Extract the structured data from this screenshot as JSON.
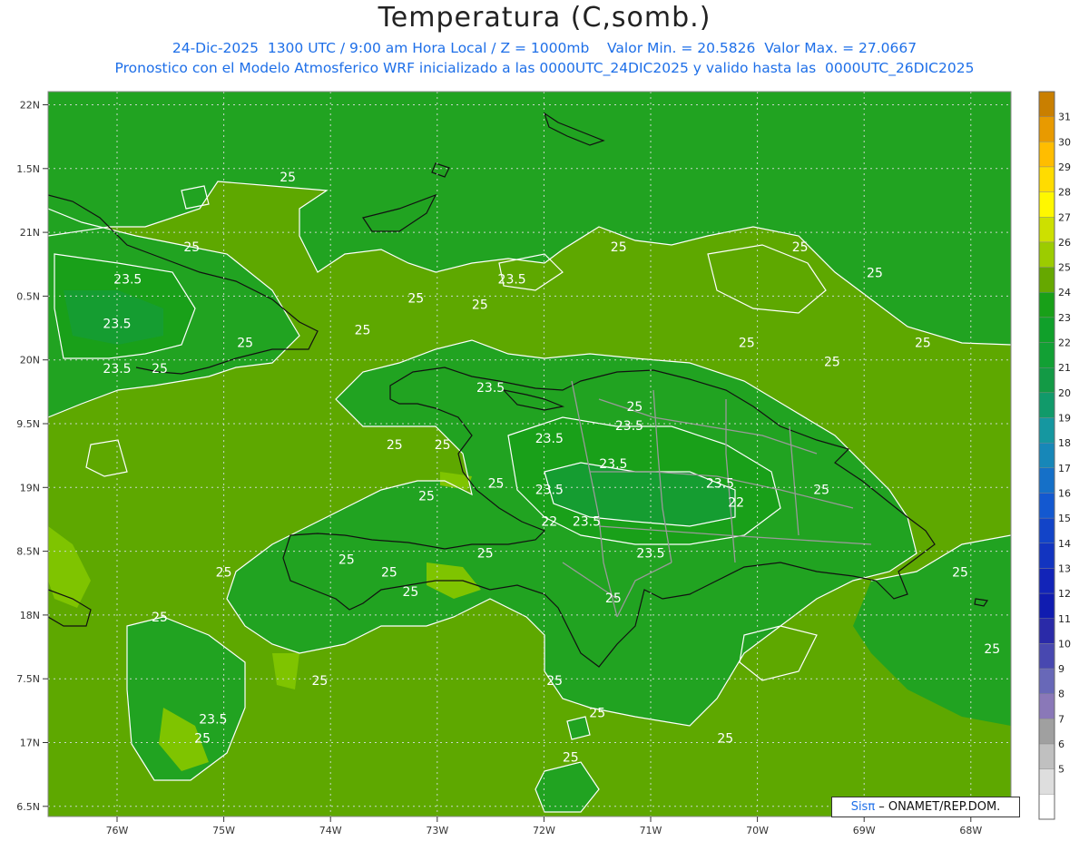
{
  "title": "Temperatura (C,somb.)",
  "subtitle_line1": "24-Dic-2025  1300 UTC / 9:00 am Hora Local / Z = 1000mb    Valor Min. = 20.5826  Valor Max. = 27.0667",
  "subtitle_line2": "Pronostico con el Modelo Atmosferico WRF inicializado a las 0000UTC_24DIC2025 y valido hasta las  0000UTC_26DIC2025",
  "credit": {
    "brand": "Sisπ",
    "text": " – ONAMET/REP.DOM."
  },
  "axes": {
    "lon_labels": [
      "76W",
      "75W",
      "74W",
      "73W",
      "72W",
      "71W",
      "70W",
      "69W",
      "68W"
    ],
    "lat_labels": [
      "22N",
      "1.5N",
      "21N",
      "0.5N",
      "20N",
      "9.5N",
      "19N",
      "8.5N",
      "18N",
      "7.5N",
      "17N",
      "6.5N"
    ]
  },
  "colorbar": {
    "labels": [
      "31",
      "30",
      "29",
      "28",
      "27",
      "26",
      "25",
      "24",
      "23",
      "22",
      "21",
      "20",
      "19",
      "18",
      "17",
      "16",
      "15",
      "14",
      "13",
      "12",
      "11",
      "10",
      "9",
      "8",
      "7",
      "6",
      "5"
    ],
    "colors": [
      "#c97f00",
      "#e89a00",
      "#ffbd00",
      "#ffdc00",
      "#fff700",
      "#cde000",
      "#9ccc00",
      "#66a800",
      "#18a018",
      "#10a02a",
      "#12a034",
      "#139a45",
      "#119a6a",
      "#1597a0",
      "#1787b8",
      "#1570c8",
      "#1358d0",
      "#1244c8",
      "#1234c0",
      "#1224b8",
      "#101cb0",
      "#2a2aa8",
      "#4848b0",
      "#6868b8",
      "#8a78b8",
      "#a0a0a0",
      "#c0c0c0",
      "#dedede",
      "#ffffff"
    ]
  },
  "colors": {
    "dark_green": "#21a321",
    "light_green": "#5ea800",
    "lime": "#7fc400",
    "contour": "#ffffff",
    "coast": "#111111",
    "border": "#9a9a9a"
  },
  "contour_labels": [
    {
      "text": "25",
      "lon": -74.4,
      "lat": 21.4
    },
    {
      "text": "23.5",
      "lon": -75.9,
      "lat": 20.6
    },
    {
      "text": "25",
      "lon": -75.3,
      "lat": 20.85
    },
    {
      "text": "23.5",
      "lon": -76.0,
      "lat": 20.25
    },
    {
      "text": "23.5",
      "lon": -76.0,
      "lat": 19.9
    },
    {
      "text": "25",
      "lon": -75.6,
      "lat": 19.9
    },
    {
      "text": "25",
      "lon": -74.8,
      "lat": 20.1
    },
    {
      "text": "25",
      "lon": -73.7,
      "lat": 20.2
    },
    {
      "text": "25",
      "lon": -73.2,
      "lat": 20.45
    },
    {
      "text": "23.5",
      "lon": -72.3,
      "lat": 20.6
    },
    {
      "text": "25",
      "lon": -72.6,
      "lat": 20.4
    },
    {
      "text": "25",
      "lon": -71.3,
      "lat": 20.85
    },
    {
      "text": "25",
      "lon": -69.6,
      "lat": 20.85
    },
    {
      "text": "25",
      "lon": -68.9,
      "lat": 20.65
    },
    {
      "text": "25",
      "lon": -70.1,
      "lat": 20.1
    },
    {
      "text": "25",
      "lon": -69.3,
      "lat": 19.95
    },
    {
      "text": "25",
      "lon": -68.45,
      "lat": 20.1
    },
    {
      "text": "23.5",
      "lon": -72.5,
      "lat": 19.75
    },
    {
      "text": "25",
      "lon": -71.15,
      "lat": 19.6
    },
    {
      "text": "23.5",
      "lon": -71.2,
      "lat": 19.45
    },
    {
      "text": "23.5",
      "lon": -71.95,
      "lat": 19.35
    },
    {
      "text": "25",
      "lon": -73.4,
      "lat": 19.3
    },
    {
      "text": "25",
      "lon": -72.95,
      "lat": 19.3
    },
    {
      "text": "23.5",
      "lon": -71.35,
      "lat": 19.15
    },
    {
      "text": "23.5",
      "lon": -71.95,
      "lat": 18.95
    },
    {
      "text": "23.5",
      "lon": -70.35,
      "lat": 19.0
    },
    {
      "text": "25",
      "lon": -72.45,
      "lat": 19.0
    },
    {
      "text": "25",
      "lon": -73.1,
      "lat": 18.9
    },
    {
      "text": "22",
      "lon": -71.95,
      "lat": 18.7
    },
    {
      "text": "23.5",
      "lon": -71.6,
      "lat": 18.7
    },
    {
      "text": "22",
      "lon": -70.2,
      "lat": 18.85
    },
    {
      "text": "25",
      "lon": -69.4,
      "lat": 18.95
    },
    {
      "text": "23.5",
      "lon": -71.0,
      "lat": 18.45
    },
    {
      "text": "25",
      "lon": -72.55,
      "lat": 18.45
    },
    {
      "text": "25",
      "lon": -73.85,
      "lat": 18.4
    },
    {
      "text": "25",
      "lon": -73.45,
      "lat": 18.3
    },
    {
      "text": "25",
      "lon": -75.0,
      "lat": 18.3
    },
    {
      "text": "25",
      "lon": -73.25,
      "lat": 18.15
    },
    {
      "text": "25",
      "lon": -71.35,
      "lat": 18.1
    },
    {
      "text": "25",
      "lon": -68.1,
      "lat": 18.3
    },
    {
      "text": "25",
      "lon": -75.6,
      "lat": 17.95
    },
    {
      "text": "25",
      "lon": -67.8,
      "lat": 17.7
    },
    {
      "text": "25",
      "lon": -74.1,
      "lat": 17.45
    },
    {
      "text": "25",
      "lon": -71.9,
      "lat": 17.45
    },
    {
      "text": "25",
      "lon": -71.5,
      "lat": 17.2
    },
    {
      "text": "23.5",
      "lon": -75.1,
      "lat": 17.15
    },
    {
      "text": "25",
      "lon": -75.2,
      "lat": 17.0
    },
    {
      "text": "25",
      "lon": -70.3,
      "lat": 17.0
    },
    {
      "text": "25",
      "lon": -71.75,
      "lat": 16.85
    }
  ]
}
